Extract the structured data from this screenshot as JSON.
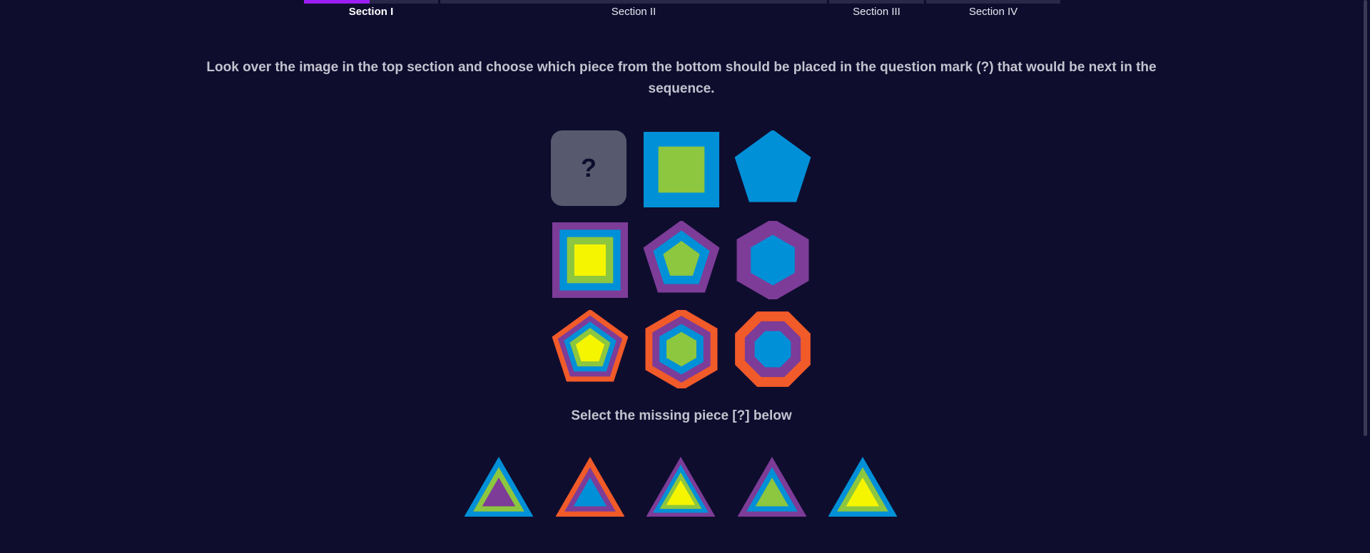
{
  "sections": [
    {
      "label": "Section I",
      "active": true,
      "progress": 0.49
    },
    {
      "label": "Section II",
      "active": false,
      "progress": 0
    },
    {
      "label": "Section III",
      "active": false,
      "progress": 0
    },
    {
      "label": "Section IV",
      "active": false,
      "progress": 0
    }
  ],
  "instructions": "Look over the image in the top section and choose which piece from the bottom should be placed in the question mark (?) that would be next in the sequence.",
  "puzzle": {
    "missing_symbol": "?",
    "cells": [
      {
        "shape": "square",
        "rings": [
          "#0090d8",
          "#8dc63f"
        ]
      },
      {
        "shape": "pentagon",
        "rings": [
          "#0090d8"
        ]
      },
      {
        "shape": "square",
        "rings": [
          "#7d3c98",
          "#0090d8",
          "#8dc63f",
          "#f5f500"
        ]
      },
      {
        "shape": "pentagon",
        "rings": [
          "#7d3c98",
          "#0090d8",
          "#8dc63f"
        ]
      },
      {
        "shape": "hexagon",
        "rings": [
          "#7d3c98",
          "#0090d8"
        ]
      },
      {
        "shape": "pentagon",
        "rings": [
          "#f15a29",
          "#7d3c98",
          "#0090d8",
          "#8dc63f",
          "#f5f500"
        ]
      },
      {
        "shape": "hexagon",
        "rings": [
          "#f15a29",
          "#7d3c98",
          "#0090d8",
          "#8dc63f"
        ]
      },
      {
        "shape": "octagon",
        "rings": [
          "#f15a29",
          "#7d3c98",
          "#0090d8"
        ]
      }
    ]
  },
  "select_label": "Select the missing piece [?] below",
  "answers": [
    {
      "shape": "triangle",
      "rings": [
        "#0090d8",
        "#8dc63f",
        "#7d3c98"
      ]
    },
    {
      "shape": "triangle",
      "rings": [
        "#f15a29",
        "#7d3c98",
        "#0090d8"
      ]
    },
    {
      "shape": "triangle",
      "rings": [
        "#7d3c98",
        "#0090d8",
        "#8dc63f",
        "#f5f500"
      ]
    },
    {
      "shape": "triangle",
      "rings": [
        "#7d3c98",
        "#0090d8",
        "#8dc63f"
      ]
    },
    {
      "shape": "triangle",
      "rings": [
        "#0090d8",
        "#8dc63f",
        "#f5f500"
      ]
    }
  ]
}
